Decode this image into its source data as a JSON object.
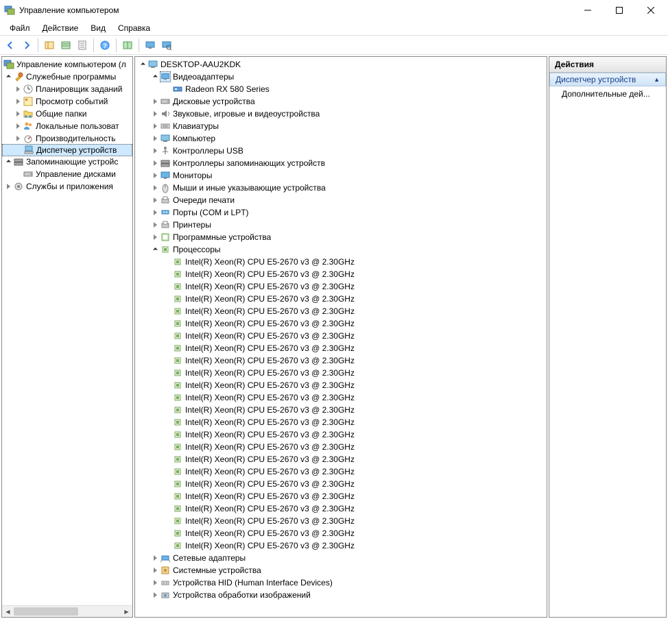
{
  "window": {
    "title": "Управление компьютером"
  },
  "menu": {
    "file": "Файл",
    "action": "Действие",
    "view": "Вид",
    "help": "Справка"
  },
  "left_tree": {
    "root": "Управление компьютером (л",
    "system_tools": "Служебные программы",
    "task_scheduler": "Планировщик заданий",
    "event_viewer": "Просмотр событий",
    "shared_folders": "Общие папки",
    "local_users": "Локальные пользоват",
    "performance": "Производительность",
    "device_manager": "Диспетчер устройств",
    "storage": "Запоминающие устройс",
    "disk_mgmt": "Управление дисками",
    "services": "Службы и приложения"
  },
  "center_tree": {
    "host": "DESKTOP-AAU2KDK",
    "video_adapters": "Видеоадаптеры",
    "gpu": "Radeon RX 580 Series",
    "disk_devices": "Дисковые устройства",
    "sound": "Звуковые, игровые и видеоустройства",
    "keyboards": "Клавиатуры",
    "computer": "Компьютер",
    "usb": "Контроллеры USB",
    "storage_ctl": "Контроллеры запоминающих устройств",
    "monitors": "Мониторы",
    "mice": "Мыши и иные указывающие устройства",
    "print_queues": "Очереди печати",
    "ports": "Порты (COM и LPT)",
    "printers": "Принтеры",
    "software_devices": "Программные устройства",
    "processors": "Процессоры",
    "cpu_model": "Intel(R) Xeon(R) CPU E5-2670 v3 @ 2.30GHz",
    "cpu_count": 24,
    "network": "Сетевые адаптеры",
    "system_devices": "Системные устройства",
    "hid": "Устройства HID (Human Interface Devices)",
    "imaging": "Устройства обработки изображений"
  },
  "actions_panel": {
    "header": "Действия",
    "subheader": "Диспетчер устройств",
    "more": "Дополнительные дей..."
  }
}
